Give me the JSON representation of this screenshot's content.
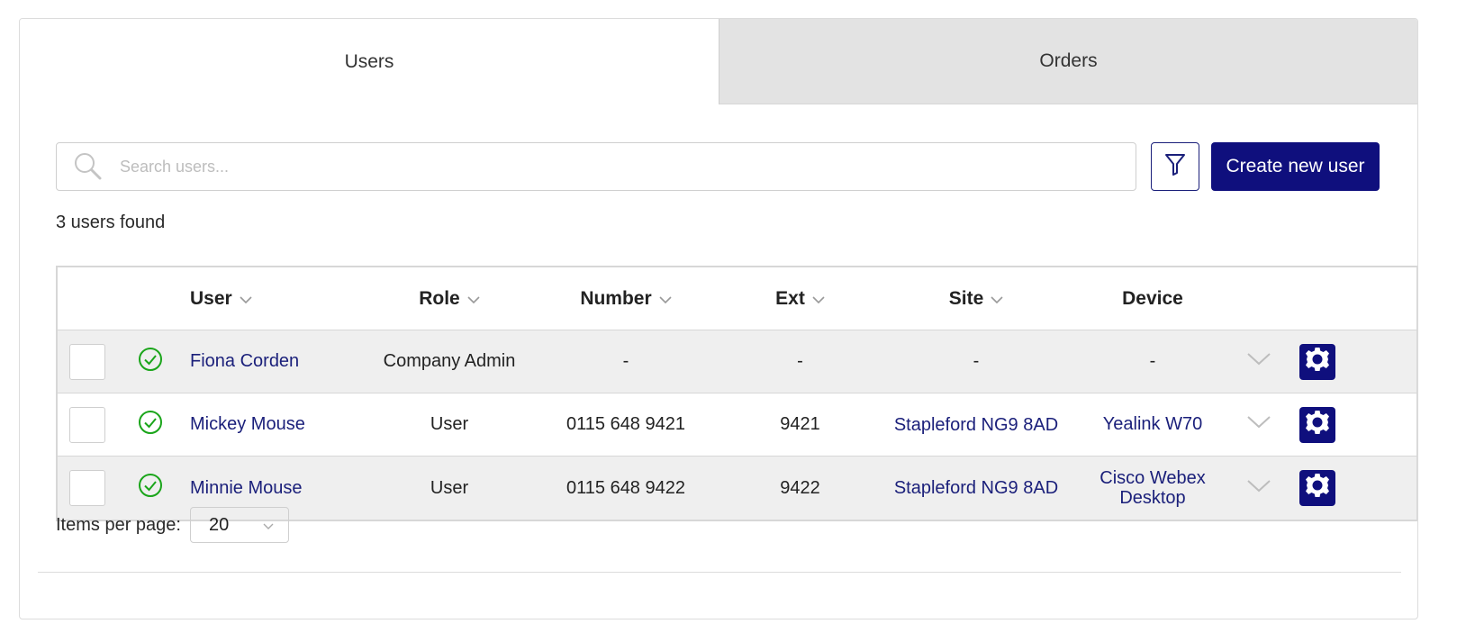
{
  "tabs": [
    {
      "label": "Users",
      "active": true
    },
    {
      "label": "Orders",
      "active": false
    }
  ],
  "search": {
    "placeholder": "Search users...",
    "value": ""
  },
  "toolbar": {
    "create_label": "Create new user"
  },
  "results": {
    "count_text": "3 users found"
  },
  "table": {
    "headers": {
      "user": "User",
      "role": "Role",
      "number": "Number",
      "ext": "Ext",
      "site": "Site",
      "device": "Device"
    },
    "rows": [
      {
        "user": "Fiona Corden",
        "role": "Company Admin",
        "number": "-",
        "ext": "-",
        "site": "-",
        "device": "-"
      },
      {
        "user": "Mickey Mouse",
        "role": "User",
        "number": "0115 648 9421",
        "ext": "9421",
        "site": "Stapleford NG9 8AD",
        "device": "Yealink W70"
      },
      {
        "user": "Minnie Mouse",
        "role": "User",
        "number": "0115 648 9422",
        "ext": "9422",
        "site": "Stapleford NG9 8AD",
        "device": "Cisco Webex Desktop"
      }
    ]
  },
  "pagination": {
    "label": "Items per page:",
    "value": "20"
  },
  "colors": {
    "accent": "#0f0f7d",
    "status_ok": "#1aa51a",
    "link": "#1a1f7a"
  }
}
